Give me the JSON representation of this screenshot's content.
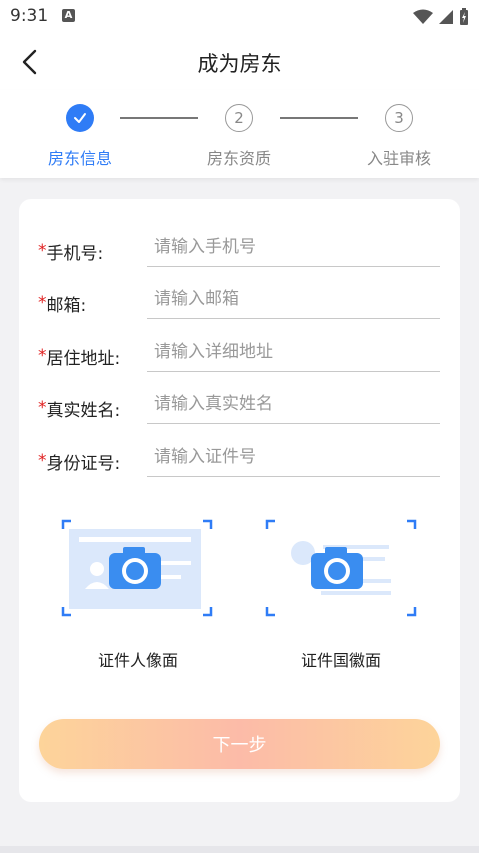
{
  "status_bar": {
    "time": "9:31",
    "notification_badge": "A"
  },
  "header": {
    "title": "成为房东",
    "back_icon": "chevron-left-icon"
  },
  "steps": [
    {
      "label": "房东信息",
      "state": "done",
      "marker": "✓"
    },
    {
      "label": "房东资质",
      "state": "pending",
      "marker": "2"
    },
    {
      "label": "入驻审核",
      "state": "pending",
      "marker": "3"
    }
  ],
  "form": {
    "fields": [
      {
        "label": "手机号:",
        "placeholder": "请输入手机号",
        "required": "*"
      },
      {
        "label": "邮箱:",
        "placeholder": "请输入邮箱",
        "required": "*"
      },
      {
        "label": "居住地址:",
        "placeholder": "请输入详细地址",
        "required": "*"
      },
      {
        "label": "真实姓名:",
        "placeholder": "请输入真实姓名",
        "required": "*"
      },
      {
        "label": "身份证号:",
        "placeholder": "请输入证件号",
        "required": "*"
      }
    ]
  },
  "uploads": {
    "front_label": "证件人像面",
    "back_label": "证件国徽面"
  },
  "next_button": {
    "label": "下一步"
  },
  "colors": {
    "accent": "#2f7cf6",
    "required": "#e02020",
    "button_gradient_start": "#fdd49a",
    "button_gradient_mid": "#fcbba8"
  }
}
